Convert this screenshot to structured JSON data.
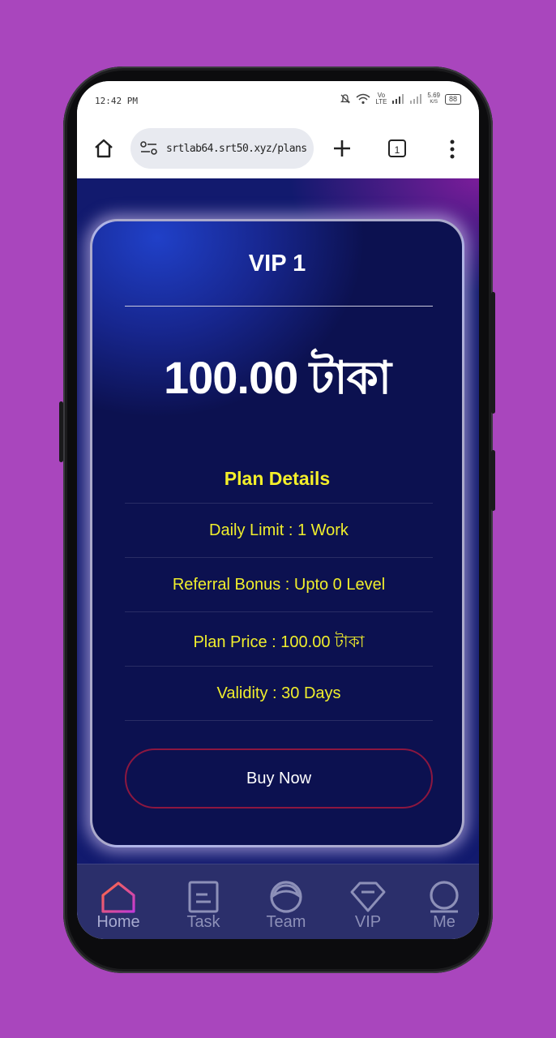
{
  "status_bar": {
    "time": "12:42 PM",
    "network_label": "Vo LTE",
    "speed": "5.69",
    "speed_unit": "K/S",
    "battery": "88"
  },
  "browser": {
    "url": "srtlab64.srt50.xyz/plans",
    "tab_count": "1"
  },
  "plan": {
    "name": "VIP 1",
    "price": "100.00 টাকা",
    "details_title": "Plan Details",
    "details": [
      "Daily Limit : 1 Work",
      "Referral Bonus : Upto 0 Level",
      "Plan Price : 100.00 টাকা",
      "Validity : 30 Days"
    ],
    "buy_label": "Buy Now"
  },
  "nav": {
    "items": [
      {
        "label": "Home",
        "icon": "home-icon",
        "active": true
      },
      {
        "label": "Task",
        "icon": "task-icon"
      },
      {
        "label": "Team",
        "icon": "team-icon"
      },
      {
        "label": "VIP",
        "icon": "diamond-icon"
      },
      {
        "label": "Me",
        "icon": "user-icon"
      }
    ]
  },
  "colors": {
    "background": "#a946bd",
    "accent_yellow": "#f0ee2c",
    "card_blue": "#17268e",
    "buy_border": "#8c1740"
  }
}
